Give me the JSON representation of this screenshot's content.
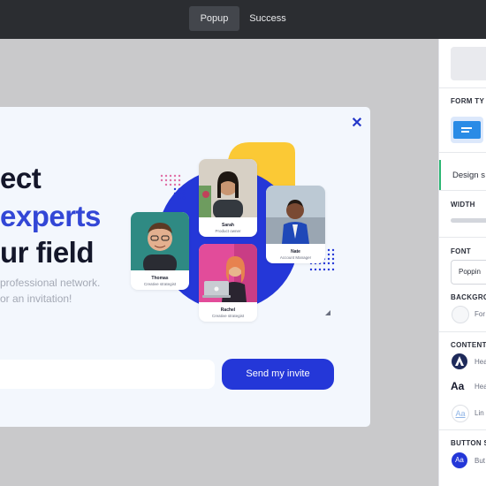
{
  "tabs": [
    {
      "label": "Popup",
      "active": true
    },
    {
      "label": "Success",
      "active": false
    }
  ],
  "popup": {
    "close_icon": "close-icon",
    "headline": [
      "ect",
      "experts",
      "ur field"
    ],
    "headline_accent": "#3347d6",
    "subtext": [
      "professional network.",
      "or an invitation!"
    ],
    "email_placeholder": "",
    "button_label": "Send my invite",
    "button_color": "#2437d8"
  },
  "cards": [
    {
      "name": "Thomas",
      "role": "Creative strategist"
    },
    {
      "name": "Sarah",
      "role": "Product owner"
    },
    {
      "name": "Nate",
      "role": "Account Manager"
    },
    {
      "name": "Rachel",
      "role": "Creative strategist"
    }
  ],
  "sidebar": {
    "form_type_label": "FORM TY",
    "design_tab": "Design s",
    "width_label": "WIDTH",
    "font_label": "FONT",
    "font_value": "Poppin",
    "background_label": "BACKGRO",
    "background_value": "For",
    "content_label": "CONTENT",
    "content_items": [
      {
        "icon": "logo-icon",
        "text": "Hea"
      },
      {
        "icon": "heading-text-icon",
        "text": "Hea"
      },
      {
        "icon": "link-text-icon",
        "text": "Lin"
      }
    ],
    "content_icon_glyphs": [
      "Aa",
      "Aa"
    ],
    "button_label": "BUTTON S",
    "button_item": {
      "glyph": "Aa",
      "text": "But"
    }
  }
}
